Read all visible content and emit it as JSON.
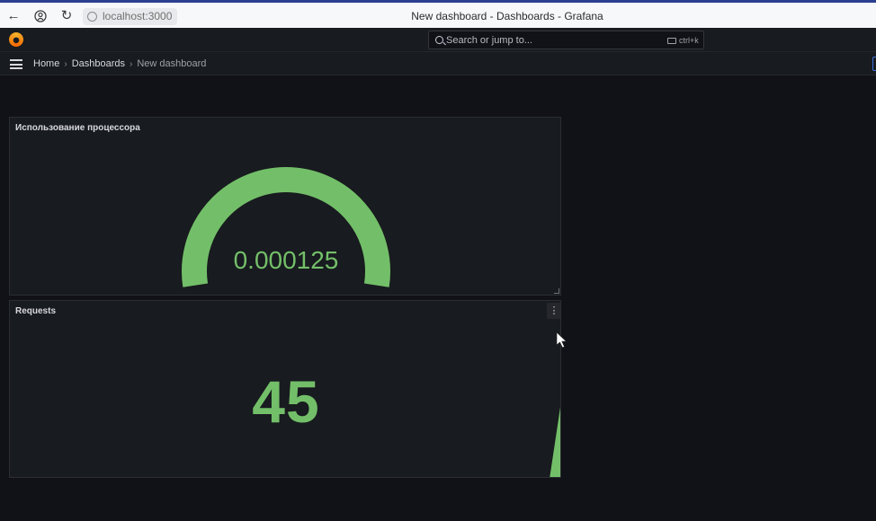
{
  "browser": {
    "url": "localhost:3000",
    "title": "New dashboard - Dashboards - Grafana"
  },
  "topbar": {
    "search_placeholder": "Search or jump to...",
    "shortcut": "ctrl+k"
  },
  "breadcrumb": {
    "home": "Home",
    "dashboards": "Dashboards",
    "current": "New dashboard"
  },
  "panels": {
    "cpu": {
      "title": "Использование процессора",
      "value": "0.000125",
      "color": "#73bf69"
    },
    "requests": {
      "title": "Requests",
      "value": "45",
      "color": "#73bf69"
    }
  },
  "icons": [
    "back-icon",
    "user-icon",
    "reload-icon",
    "globe-icon",
    "grafana-logo-icon",
    "search-icon",
    "keyboard-icon",
    "hamburger-menu-icon",
    "chevron-right-icon",
    "kebab-menu-icon",
    "resize-icon",
    "mouse-cursor-icon"
  ]
}
